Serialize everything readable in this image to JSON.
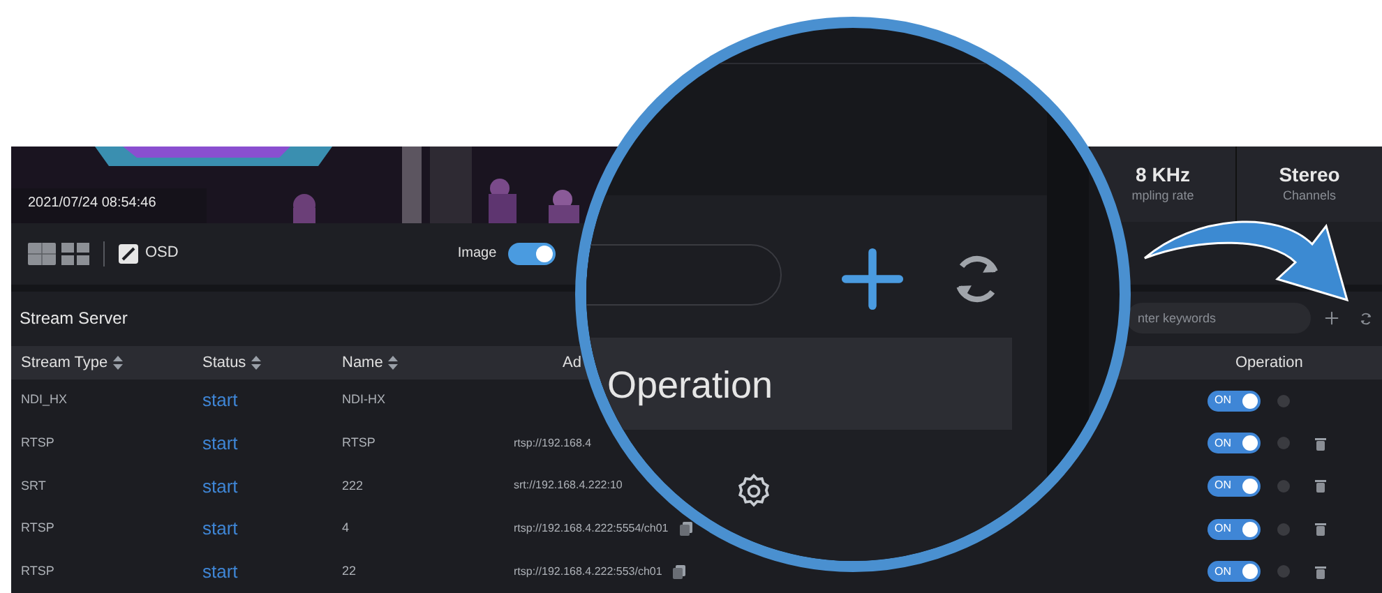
{
  "video": {
    "timestamp": "2021/07/24 08:54:46"
  },
  "stats": [
    {
      "value": "8 KHz",
      "label": "mpling rate"
    },
    {
      "value": "Stereo",
      "label": "Channels"
    }
  ],
  "toolbar": {
    "osd_label": "OSD",
    "image_label": "Image",
    "image_on": true
  },
  "stream_server": {
    "title": "Stream Server",
    "search": {
      "placeholder": "nter keywords"
    }
  },
  "table": {
    "columns": [
      {
        "label": "Stream Type",
        "sortable": true
      },
      {
        "label": "Status",
        "sortable": true
      },
      {
        "label": "Name",
        "sortable": true
      },
      {
        "label": "Ad",
        "sortable": false
      },
      {
        "label": "Operation",
        "sortable": false
      }
    ],
    "rows": [
      {
        "stream_type": "NDI_HX",
        "status": "start",
        "name": "NDI-HX",
        "switch_label": "ON",
        "on": true,
        "copyable": false,
        "deletable": false
      },
      {
        "stream_type": "RTSP",
        "status": "start",
        "name": "RTSP",
        "address": "rtsp://192.168.4",
        "switch_label": "ON",
        "on": true,
        "copyable": false,
        "deletable": true
      },
      {
        "stream_type": "SRT",
        "status": "start",
        "name": "222",
        "address": "srt://192.168.4.222:10",
        "switch_label": "ON",
        "on": true,
        "copyable": false,
        "deletable": true
      },
      {
        "stream_type": "RTSP",
        "status": "start",
        "name": "4",
        "address": "rtsp://192.168.4.222:5554/ch01",
        "switch_label": "ON",
        "on": true,
        "copyable": true,
        "deletable": true
      },
      {
        "stream_type": "RTSP",
        "status": "start",
        "name": "22",
        "address": "rtsp://192.168.4.222:553/ch01",
        "switch_label": "ON",
        "on": true,
        "copyable": true,
        "deletable": true
      }
    ]
  },
  "magnifier": {
    "header": "Operation"
  }
}
